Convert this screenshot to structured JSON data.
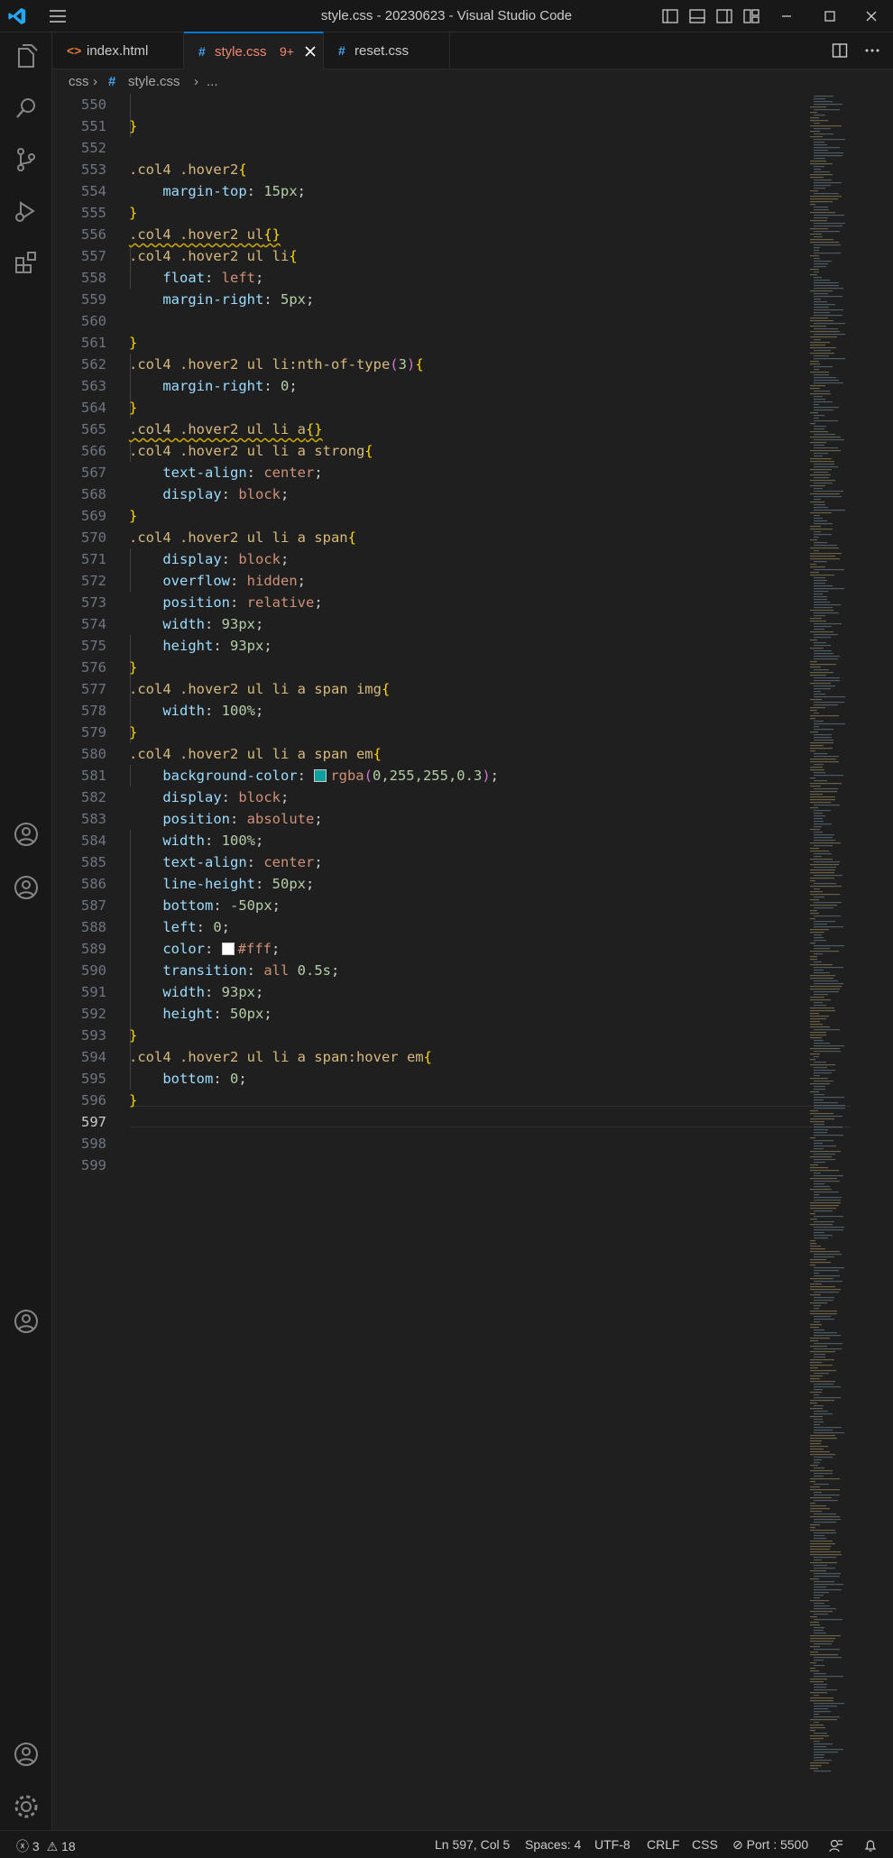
{
  "window": {
    "title": "style.css - 20230623 - Visual Studio Code"
  },
  "tabs": [
    {
      "label": "index.html",
      "icon": "html-file-icon"
    },
    {
      "label": "style.css",
      "badge": "9+",
      "icon": "css-file-icon",
      "active": true
    },
    {
      "label": "reset.css",
      "icon": "css-file-icon"
    }
  ],
  "breadcrumb": {
    "folder": "css",
    "file": "style.css",
    "symbol": "..."
  },
  "line_numbers": [
    "550",
    "551",
    "552",
    "553",
    "554",
    "555",
    "556",
    "557",
    "558",
    "559",
    "560",
    "561",
    "562",
    "563",
    "564",
    "565",
    "566",
    "567",
    "568",
    "569",
    "570",
    "571",
    "572",
    "573",
    "574",
    "575",
    "576",
    "577",
    "578",
    "579",
    "580",
    "581",
    "582",
    "583",
    "584",
    "585",
    "586",
    "587",
    "588",
    "589",
    "590",
    "591",
    "592",
    "593",
    "594",
    "595",
    "596",
    "597",
    "598",
    "599"
  ],
  "code": {
    "l553": ".col4 .hover2",
    "l556": ".col4 .hover2 ul",
    "l557": ".col4 .hover2 ul li",
    "l562": ".col4 .hover2 ul li:nth-of-type",
    "l562_arg": "3",
    "l565": ".col4 .hover2 ul li a",
    "l566": ".col4 .hover2 ul li a strong",
    "l570": ".col4 .hover2 ul li a span",
    "l577": ".col4 .hover2 ul li a span img",
    "l580": ".col4 .hover2 ul li a span em",
    "l594": ".col4 .hover2 ul li a span:hover em",
    "p_margin_top": "margin-top",
    "v_15px": "15px",
    "p_float": "float",
    "v_left": "left",
    "p_margin_right": "margin-right",
    "v_5px": "5px",
    "v_0": "0",
    "p_text_align": "text-align",
    "v_center": "center",
    "p_display": "display",
    "v_block": "block",
    "p_overflow": "overflow",
    "v_hidden": "hidden",
    "p_position": "position",
    "v_relative": "relative",
    "v_absolute": "absolute",
    "p_width": "width",
    "v_93px": "93px",
    "v_100": "100%",
    "p_height": "height",
    "v_50px": "50px",
    "p_bg": "background-color",
    "v_rgba_fn": "rgba",
    "v_rgba_args": "0,255,255,0.3",
    "p_line_height": "line-height",
    "p_bottom": "bottom",
    "v_m50px": "-50px",
    "p_left": "left",
    "p_color": "color",
    "v_fff": "#fff",
    "p_transition": "transition",
    "v_all": "all",
    "v_05s": "0.5s"
  },
  "colors": {
    "accent": "#0078d4",
    "swatch_rgba": "#0f9f9f",
    "swatch_white": "#ffffff"
  },
  "status": {
    "errors": "3",
    "warnings": "18",
    "position": "Ln 597, Col 5",
    "spaces": "Spaces: 4",
    "encoding": "UTF-8",
    "eol": "CRLF",
    "language": "CSS",
    "port": "Port : 5500"
  }
}
